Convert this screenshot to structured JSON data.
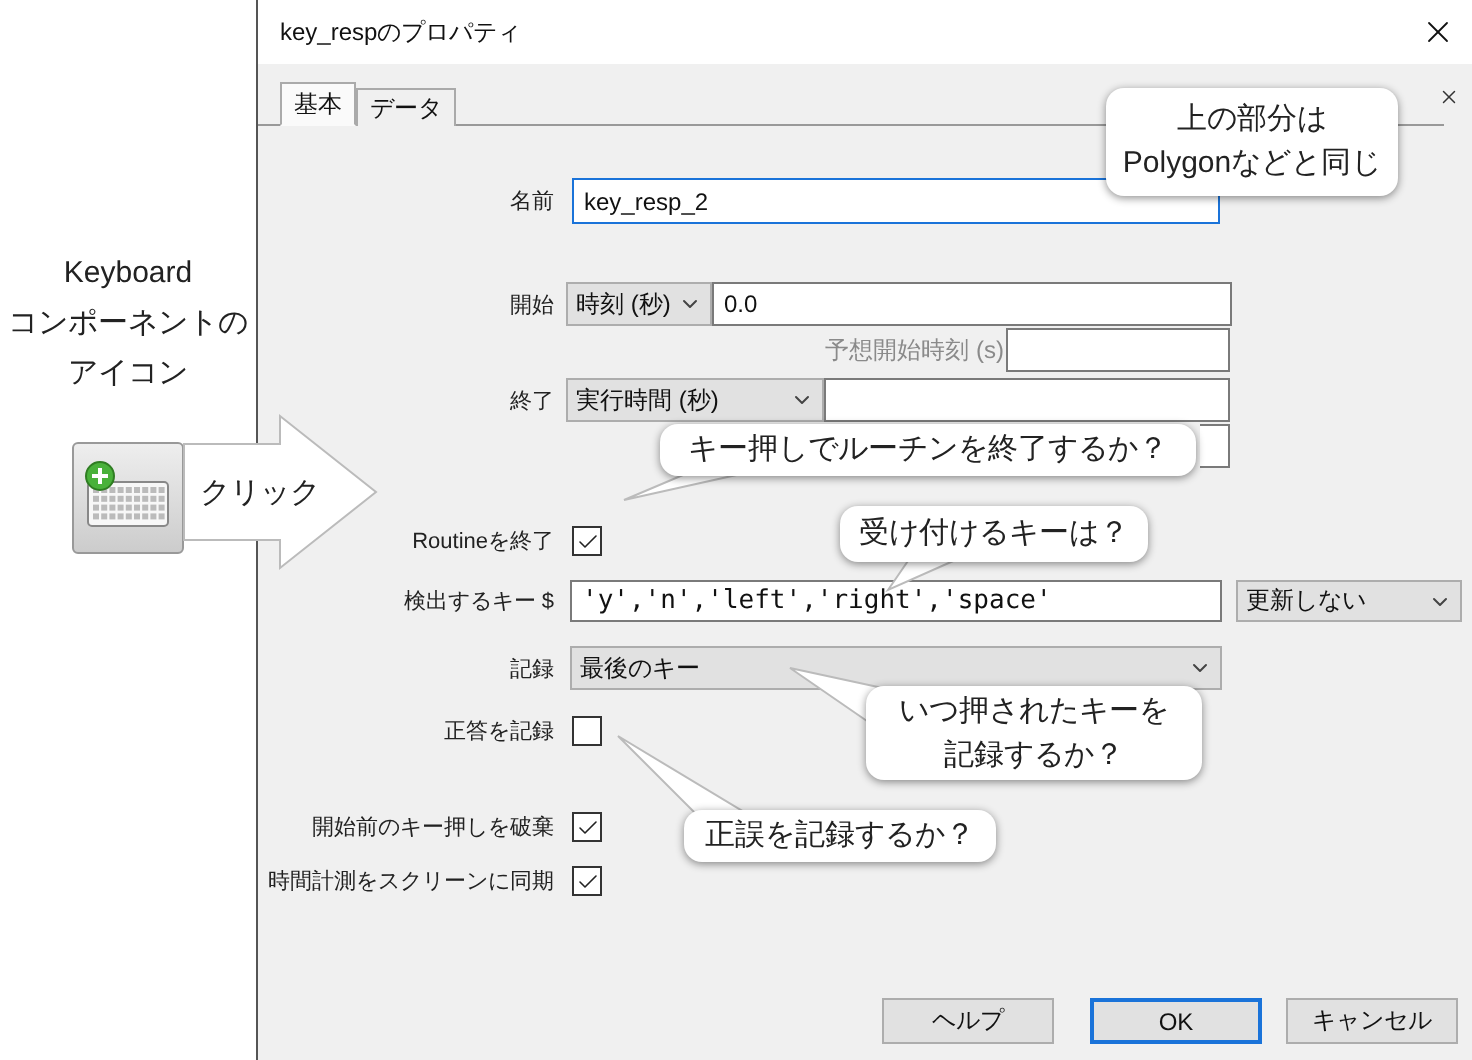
{
  "annotation": {
    "caption": [
      "Keyboard",
      "コンポーネントの",
      "アイコン"
    ],
    "arrow_label": "クリック"
  },
  "window": {
    "title": "key_respのプロパティ"
  },
  "tabs": [
    {
      "label": "基本",
      "selected": true
    },
    {
      "label": "データ",
      "selected": false
    }
  ],
  "name": {
    "label": "名前",
    "value": "key_resp_2"
  },
  "start": {
    "label": "開始",
    "type": "時刻 (秒)",
    "value": "0.0",
    "expected_label": "予想開始時刻 (s)"
  },
  "stop": {
    "label": "終了",
    "type": "実行時間 (秒)"
  },
  "force_end": {
    "label": "Routineを終了",
    "checked": true
  },
  "keys": {
    "label": "検出するキー $",
    "value": "'y','n','left','right','space'",
    "update": "更新しない"
  },
  "store": {
    "label": "記録",
    "value": "最後のキー"
  },
  "store_correct": {
    "label": "正答を記録",
    "checked": false
  },
  "discard_prev": {
    "label": "開始前のキー押しを破棄",
    "checked": true
  },
  "sync_screen": {
    "label": "時間計測をスクリーンに同期",
    "checked": true
  },
  "buttons": [
    {
      "label": "ヘルプ",
      "default": false
    },
    {
      "label": "OK",
      "default": true
    },
    {
      "label": "キャンセル",
      "default": false
    }
  ],
  "callouts": [
    [
      "上の部分は",
      "Polygonなどと同じ"
    ],
    [
      "キー押しでルーチンを終了するか？"
    ],
    [
      "受け付けるキーは？"
    ],
    [
      "いつ押されたキーを",
      "記録するか？"
    ],
    [
      "正誤を記録するか？"
    ]
  ]
}
